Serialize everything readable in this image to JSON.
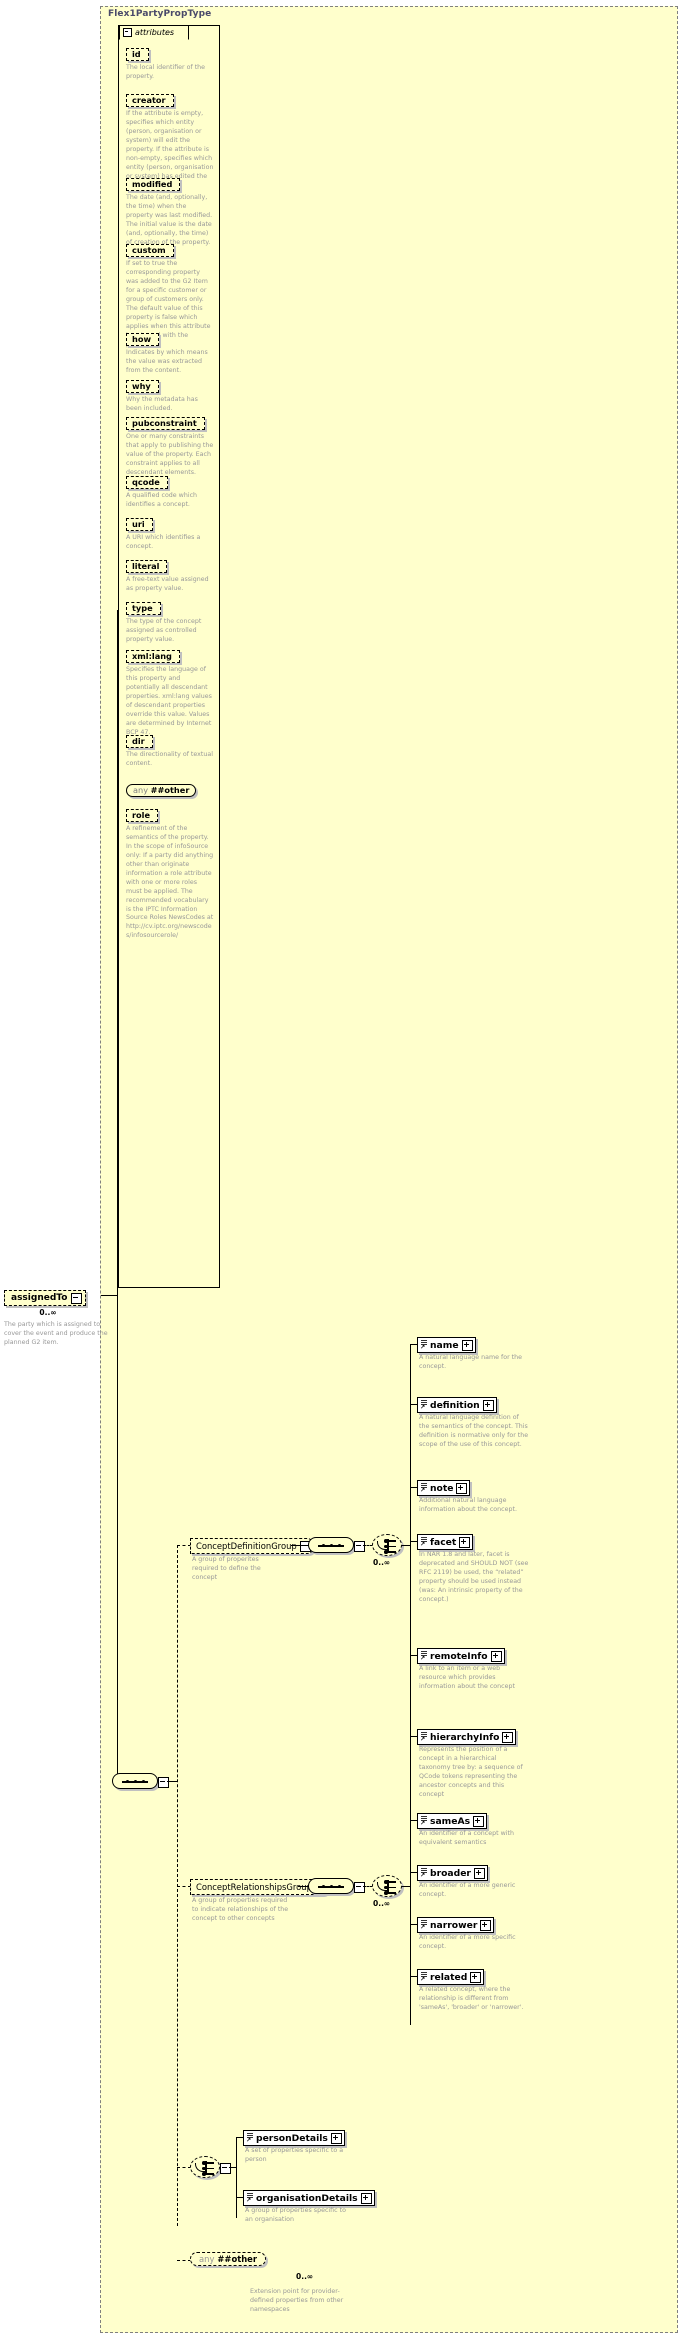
{
  "type_name": "Flex1PartyPropType",
  "attributes_panel": {
    "tab_label": "attributes",
    "items": [
      {
        "name": "id",
        "desc": "The local identifier of the property."
      },
      {
        "name": "creator",
        "desc": "If the attribute is empty, specifies which entity (person, organisation or system) will edit the property. If the attribute is non-empty, specifies which entity (person, organisation or system) has edited the property."
      },
      {
        "name": "modified",
        "desc": "The date (and, optionally, the time) when the property was last modified. The initial value is the date (and, optionally, the time) of creation of the property."
      },
      {
        "name": "custom",
        "desc": "If set to true the corresponding property was added to the G2 Item for a specific customer or group of customers only. The default value of this property is false which applies when this attribute is not used with the property."
      },
      {
        "name": "how",
        "desc": "Indicates by which means the value was extracted from the content."
      },
      {
        "name": "why",
        "desc": "Why the metadata has been included."
      },
      {
        "name": "pubconstraint",
        "desc": "One or many constraints that apply to publishing the value of the property. Each constraint applies to all descendant elements."
      },
      {
        "name": "qcode",
        "desc": "A qualified code which identifies a concept."
      },
      {
        "name": "uri",
        "desc": "A URI which identifies a concept."
      },
      {
        "name": "literal",
        "desc": "A free-text value assigned as property value."
      },
      {
        "name": "type",
        "desc": "The type of the concept assigned as controlled property value."
      },
      {
        "name": "xml:lang",
        "desc": "Specifies the language of this property and potentially all descendant properties. xml:lang values of descendant properties override this value. Values are determined by Internet BCP 47."
      },
      {
        "name": "dir",
        "desc": "The directionality of textual content."
      },
      {
        "name": "any ##other",
        "desc": "",
        "is_any": true,
        "any_prefix": "any",
        "any_suffix": "##other"
      },
      {
        "name": "role",
        "desc": "A refinement of the semantics of the property. In the scope of infoSource only: If a party did anything other than originate information a role attribute with one or more roles must be applied. The recommended vocabulary is the IPTC Information Source Roles NewsCodes at http://cv.iptc.org/newscodes/infosourcerole/"
      }
    ]
  },
  "root_element": {
    "name": "assignedTo",
    "occurs": "0..∞",
    "desc": "The party which is assigned to cover the event and produce the planned G2 item."
  },
  "groups": [
    {
      "name": "ConceptDefinitionGroup",
      "desc": "A group of properites required to define the concept",
      "occurs": "0..∞",
      "elements": [
        {
          "name": "name",
          "desc": "A natural language name for the concept."
        },
        {
          "name": "definition",
          "desc": "A natural language definition of the semantics of the concept. This definition is normative only for the scope of the use of this concept."
        },
        {
          "name": "note",
          "desc": "Additional natural language information about the concept."
        },
        {
          "name": "facet",
          "desc": "In NAR 1.8 and later, facet is deprecated and SHOULD NOT (see RFC 2119) be used, the “related” property should be used instead (was: An intrinsic property of the concept.)"
        },
        {
          "name": "remoteInfo",
          "desc": "A link to an item or a web resource which provides information about the concept"
        },
        {
          "name": "hierarchyInfo",
          "desc": "Represents the position of a concept in a hierarchical taxonomy tree by: a sequence of QCode tokens representing the ancestor concepts and this concept"
        }
      ]
    },
    {
      "name": "ConceptRelationshipsGroup",
      "desc": "A group of properties required to indicate relationships of the concept to other concepts",
      "occurs": "0..∞",
      "elements": [
        {
          "name": "sameAs",
          "desc": "An identifier of a concept with equivalent semantics"
        },
        {
          "name": "broader",
          "desc": "An identifier of a more generic concept."
        },
        {
          "name": "narrower",
          "desc": "An identifier of a more specific concept."
        },
        {
          "name": "related",
          "desc": "A related concept, where the relationship is different from 'sameAs', 'broader' or 'narrower'."
        }
      ]
    }
  ],
  "details_choice": {
    "elements": [
      {
        "name": "personDetails",
        "desc": "A set of properties specific to a person"
      },
      {
        "name": "organisationDetails",
        "desc": "A group of properties specific to an organisation"
      }
    ]
  },
  "extension_any": {
    "any_prefix": "any",
    "any_suffix": "##other",
    "occurs": "0..∞",
    "desc": "Extension point for provider-defined properties from other namespaces"
  },
  "colors": {
    "background": "#ffffcc",
    "description_text": "#999999",
    "title_text": "#4a4a6a",
    "line": "#000000",
    "shadow": "#c0c0c0"
  }
}
